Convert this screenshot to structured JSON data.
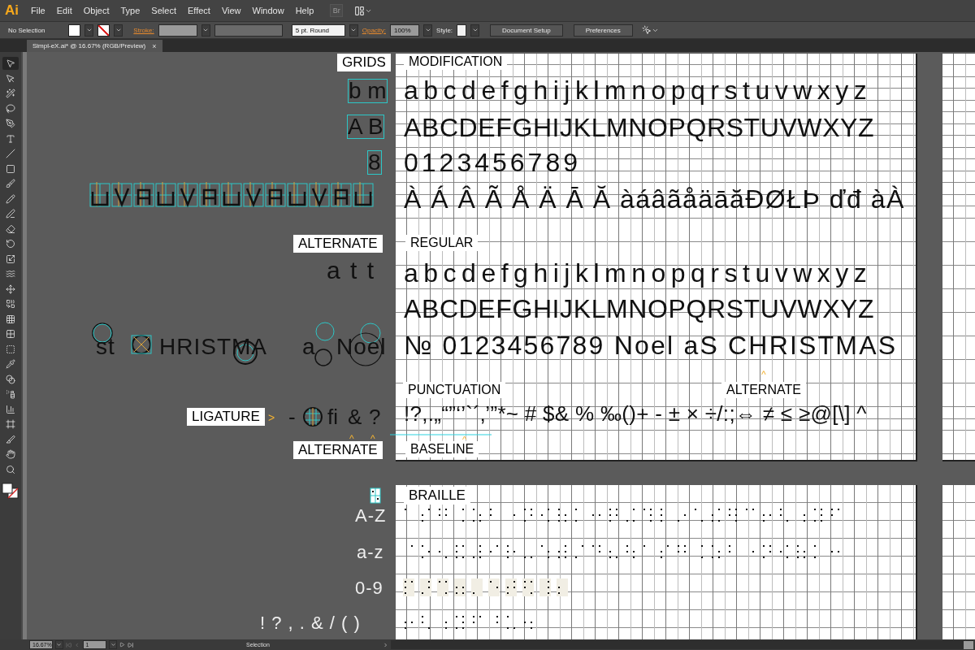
{
  "logo": "Ai",
  "menu": [
    "File",
    "Edit",
    "Object",
    "Type",
    "Select",
    "Effect",
    "View",
    "Window",
    "Help"
  ],
  "bridge_button": "Br",
  "control_bar": {
    "selection": "No Selection",
    "stroke_label": "Stroke:",
    "brush": "5 pt. Round",
    "opacity_label": "Opacity:",
    "opacity": "100%",
    "style_label": "Style:",
    "buttons": [
      "Document Setup",
      "Preferences"
    ]
  },
  "document_tab": {
    "title": "Simpl-eX.ai* @ 16.67% (RGB/Preview)",
    "close": "×"
  },
  "tools": [
    {
      "selected": true
    },
    {
      "selected": false
    },
    {
      "selected": false
    },
    {
      "selected": false
    },
    {
      "selected": false
    },
    {
      "selected": false
    },
    {
      "selected": false
    },
    {
      "selected": false
    },
    {
      "selected": false
    },
    {
      "selected": false
    },
    {
      "selected": false
    },
    {
      "selected": false
    },
    {
      "selected": false
    },
    {
      "selected": false
    },
    {
      "selected": false
    },
    {
      "selected": false
    },
    {
      "selected": false
    },
    {
      "selected": false
    },
    {
      "selected": false
    },
    {
      "selected": false
    },
    {
      "selected": false
    },
    {
      "selected": false
    },
    {
      "selected": false
    },
    {
      "selected": false
    },
    {
      "selected": false
    },
    {
      "selected": false
    },
    {
      "selected": false
    },
    {
      "selected": false
    }
  ],
  "canvas": {
    "grids_label": "GRIDS",
    "grid_samples": [
      "b m",
      "A B",
      "8"
    ],
    "alternate_label": "ALTERNATE",
    "alternate_sample": "a t t",
    "construction_samples": [
      "st",
      "HRISTMA",
      "a",
      "Noel"
    ],
    "ligature_label": "LIGATURE",
    "ligature_pointer": ">",
    "ligature_samples": [
      "-",
      "fi",
      "&",
      "?"
    ],
    "ligature_markers": [
      "^",
      "^"
    ],
    "ligature_alternate_label": "ALTERNATE"
  },
  "specimen": {
    "modification_label": "MODIFICATION",
    "modification_lines": [
      "abcdefghijklmnopqrstuvwxyz",
      "ABCDEFGHIJKLMNOPQRSTUVWXYZ",
      "0123456789",
      "À Á Â Ã Å Ä Ā Ă àáâãåäāăĐØŁÞ ďđ àÀ"
    ],
    "regular_label": "REGULAR",
    "regular_lines": [
      "abcdefghijklmnopqrstuvwxyz",
      "ABCDEFGHIJKLMNOPQRSTUVWXYZ",
      "№ 0123456789 Noel aS CHRISTMAS"
    ],
    "punctuation_label": "PUNCTUATION",
    "alternate_label": "ALTERNATE",
    "alternate_marker": "^",
    "punctuation_line": "!?,.„“”‘’`´‚’”*~ # $& % ‰()+ - ± × ÷/:;⇔ ≠ ≤ ≥@[\\] ^",
    "baseline_marker": "^",
    "baseline_label": "BASELINE"
  },
  "braille": {
    "label": "BRAILLE",
    "rows": [
      {
        "label": "A-Z"
      },
      {
        "label": "a-z"
      },
      {
        "label": "0-9"
      },
      {
        "label": "! ? , . & / ( )"
      }
    ]
  },
  "status_bar": {
    "zoom": "16.67%",
    "page": "1",
    "tool": "Selection"
  }
}
